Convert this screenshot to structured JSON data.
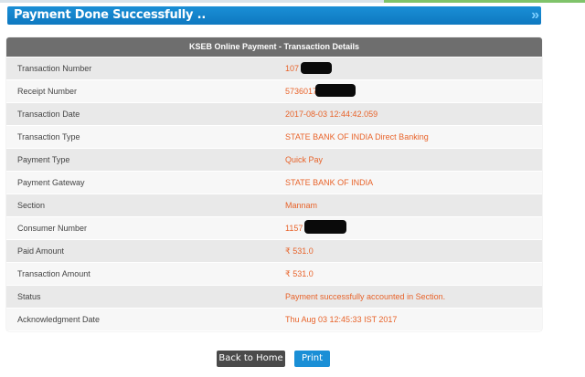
{
  "banner": {
    "title": "Payment Done Successfully ..",
    "chevron": "»"
  },
  "table": {
    "header": "KSEB Online Payment - Transaction Details",
    "rows": [
      {
        "label": "Transaction Number",
        "value": "107"
      },
      {
        "label": "Receipt Number",
        "value": "57360170"
      },
      {
        "label": "Transaction Date",
        "value": "2017-08-03 12:44:42.059"
      },
      {
        "label": "Transaction Type",
        "value": "STATE BANK OF INDIA Direct Banking"
      },
      {
        "label": "Payment Type",
        "value": "Quick Pay"
      },
      {
        "label": "Payment Gateway",
        "value": "STATE BANK OF INDIA"
      },
      {
        "label": "Section",
        "value": "Mannam"
      },
      {
        "label": "Consumer Number",
        "value": "1157"
      },
      {
        "label": "Paid Amount",
        "value": "₹ 531.0"
      },
      {
        "label": "Transaction Amount",
        "value": "₹ 531.0"
      },
      {
        "label": "Status",
        "value": "Payment successfully accounted in Section."
      },
      {
        "label": "Acknowledgment Date",
        "value": "Thu Aug 03 12:45:33 IST 2017"
      }
    ]
  },
  "buttons": {
    "back_home": "Back to Home",
    "print": "Print"
  },
  "colors": {
    "banner": "#1a8fd6",
    "header": "#6e6e6e",
    "value_text": "#e8632a",
    "print_button": "#1a8fd6",
    "home_button": "#4a4a4a"
  }
}
